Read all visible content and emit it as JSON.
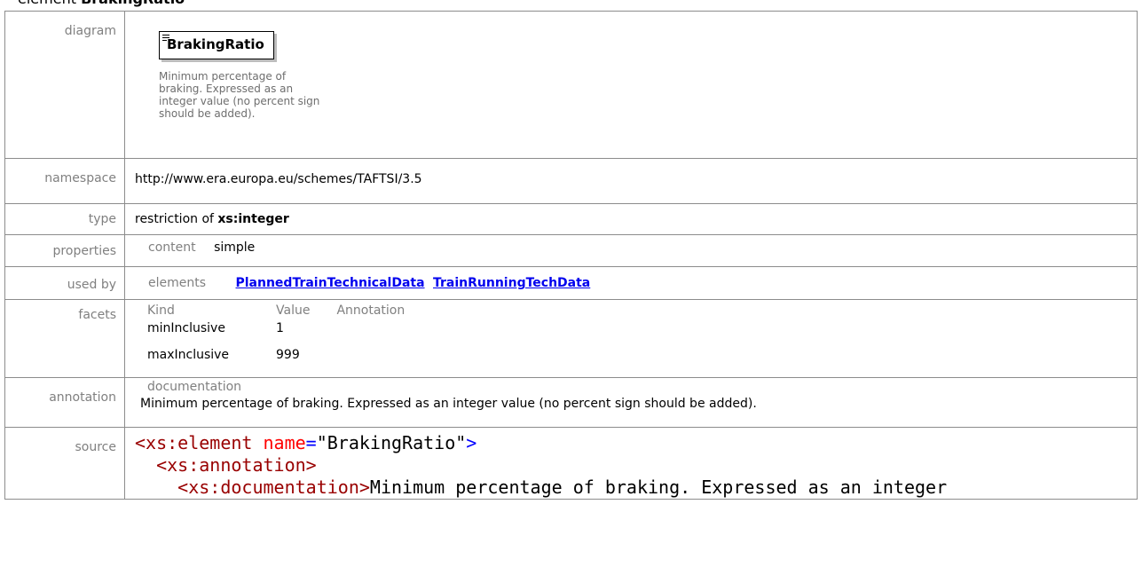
{
  "heading": {
    "prefix": "element",
    "name": "BrakingRatio"
  },
  "rows": {
    "diagram": {
      "label": "diagram",
      "box_title": "BrakingRatio",
      "doc": "Minimum percentage of braking. Expressed as an integer value (no percent sign should be added)."
    },
    "namespace": {
      "label": "namespace",
      "value": "http://www.era.europa.eu/schemes/TAFTSI/3.5"
    },
    "type": {
      "label": "type",
      "prefix": "restriction of",
      "base": "xs:integer"
    },
    "properties": {
      "label": "properties",
      "key": "content",
      "value": "simple"
    },
    "used_by": {
      "label": "used by",
      "key": "elements",
      "links": [
        "PlannedTrainTechnicalData",
        "TrainRunningTechData"
      ]
    },
    "facets": {
      "label": "facets",
      "headers": [
        "Kind",
        "Value",
        "Annotation"
      ],
      "items": [
        {
          "kind": "minInclusive",
          "value": "1"
        },
        {
          "kind": "maxInclusive",
          "value": "999"
        }
      ]
    },
    "annotation": {
      "label": "annotation",
      "key": "documentation",
      "text": "Minimum percentage of braking. Expressed as an integer value (no percent sign should be added)."
    },
    "source": {
      "label": "source",
      "line1_tag": "<xs:element",
      "line1_attr": "name",
      "line1_eq": "=",
      "line1_val": "\"BrakingRatio\"",
      "line1_close": ">",
      "line2": "<xs:annotation>",
      "line3_tag": "<xs:documentation>",
      "line3_text": "Minimum percentage of braking. Expressed as an integer"
    }
  }
}
